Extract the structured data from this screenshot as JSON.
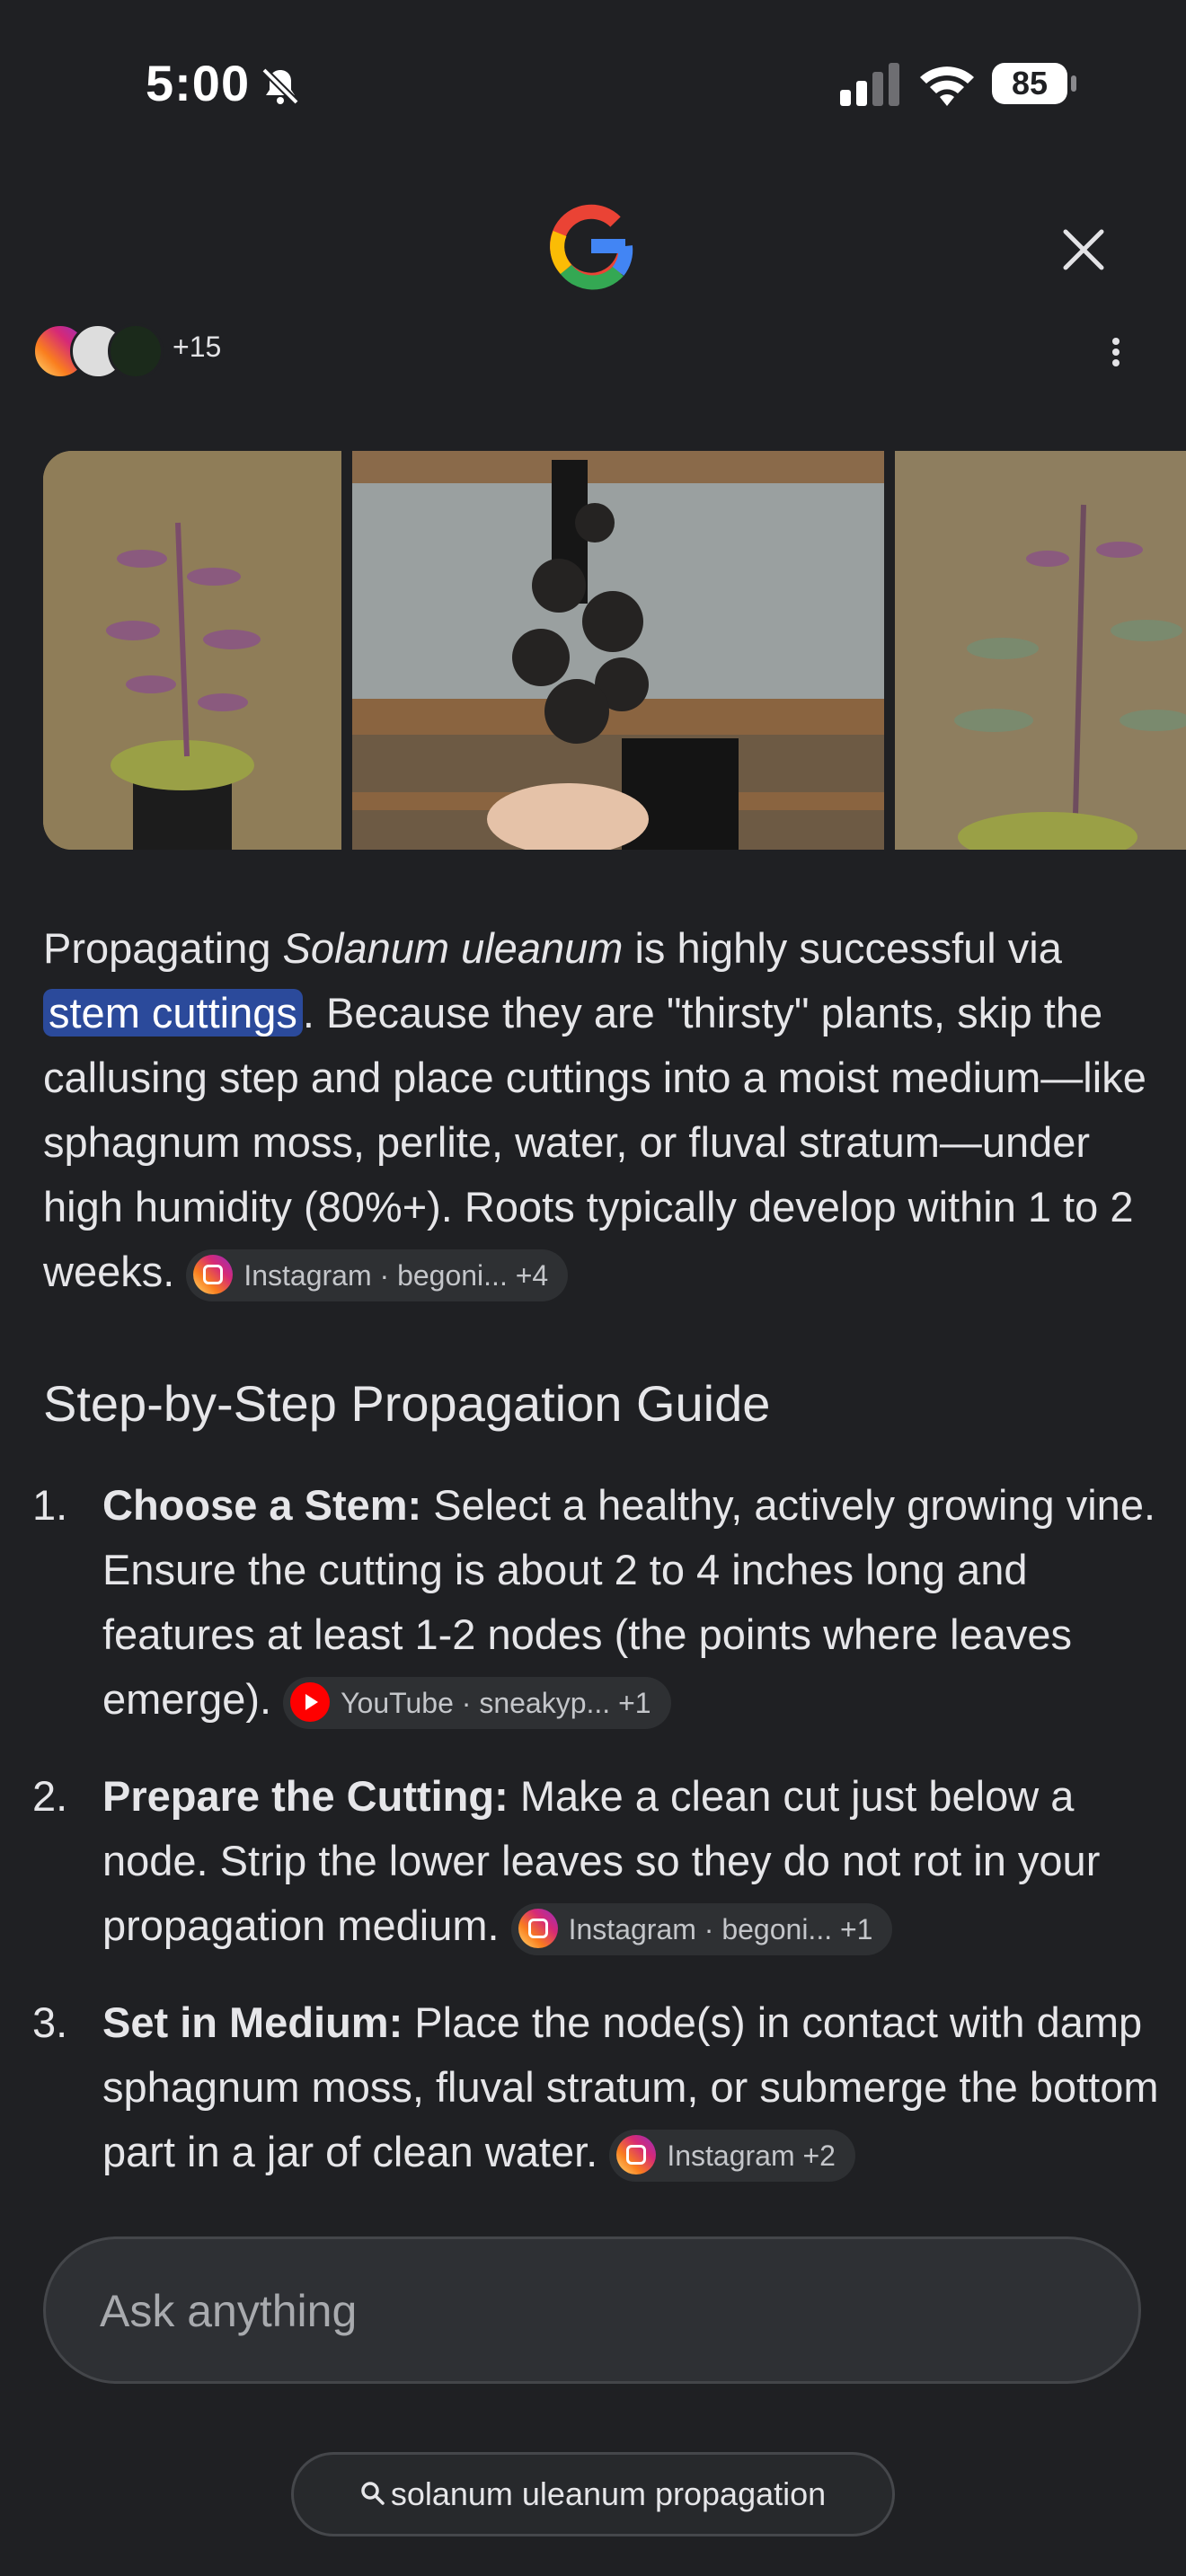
{
  "status": {
    "time": "5:00",
    "battery": "85"
  },
  "sources": {
    "more_count": "+15"
  },
  "paragraph": {
    "p1": "Propagating ",
    "species": "Solanum uleanum",
    "p2": " is highly successful via ",
    "highlight": "stem cuttings",
    "p3": ". Because they are \"thirsty\" plants, skip the callusing step and place cuttings into a moist medium—like sphagnum moss, perlite, water, or fluval stratum—under high humidity (80%+). Roots typically develop within 1 to 2 weeks.",
    "chip": "Instagram · begoni... +4"
  },
  "guide": {
    "title": "Step-by-Step Propagation Guide",
    "steps": [
      {
        "num": "1.",
        "title": "Choose a Stem:",
        "text": " Select a healthy, actively growing vine. Ensure the cutting is about 2 to 4 inches long and features at least 1-2 nodes (the points where leaves emerge).",
        "chip_source": "YouTube · sneakyp... ",
        "chip_more": "+1"
      },
      {
        "num": "2.",
        "title": "Prepare the Cutting:",
        "text": " Make a clean cut just below a node. Strip the lower leaves so they do not rot in your propagation medium.",
        "chip_source": "Instagram · begoni... ",
        "chip_more": "+1"
      },
      {
        "num": "3.",
        "title": "Set in Medium:",
        "text": " Place the node(s) in contact with damp sphagnum moss, fluval stratum, or submerge the bottom part in a jar of clean water.",
        "chip_source": "Instagram ",
        "chip_more": "+2"
      }
    ]
  },
  "ask": {
    "placeholder": "Ask anything"
  },
  "suggestion": {
    "query": "solanum uleanum propagation"
  },
  "colors": {
    "background": "#1f2023",
    "highlight": "#2b4a9b",
    "chip": "#2e3033"
  }
}
